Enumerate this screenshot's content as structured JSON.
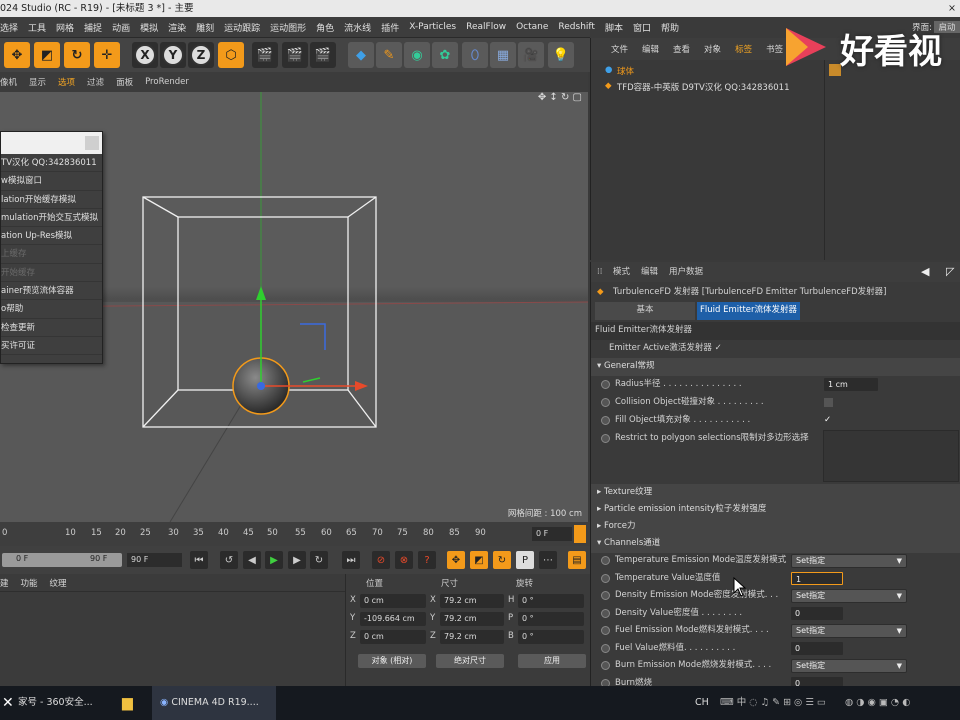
{
  "title_bar": {
    "title": "024 Studio (RC - R19) - [未标题 3 *] - 主要",
    "close": "×"
  },
  "menu": [
    "选择",
    "工具",
    "网格",
    "捕捉",
    "动画",
    "模拟",
    "渲染",
    "雕刻",
    "运动跟踪",
    "运动图形",
    "角色",
    "流水线",
    "插件",
    "X-Particles",
    "RealFlow",
    "Octane",
    "Redshift",
    "脚本",
    "窗口",
    "帮助"
  ],
  "viewport_menu": [
    "像机",
    "显示",
    "选项",
    "过滤",
    "面板",
    "ProRender"
  ],
  "popup_items": [
    "TV汉化 QQ:342836011",
    "w模拟窗口",
    "lation开始缓存模拟",
    "mulation开始交互式模拟",
    "ation Up-Res模拟",
    "上缓存",
    "开始缓存",
    "ainer预览流体容器",
    "o帮助",
    "检查更新",
    "买许可证"
  ],
  "viewport": {
    "grid_spacing": "网格间距 : 100 cm"
  },
  "timeline": {
    "ticks": [
      "0",
      "10",
      "15",
      "20",
      "25",
      "30",
      "35",
      "40",
      "45",
      "50",
      "55",
      "60",
      "65",
      "70",
      "75",
      "80",
      "85",
      "90"
    ],
    "current": "0 F"
  },
  "playback": {
    "start": "0 F",
    "end": "90 F",
    "end2": "90 F"
  },
  "lower_left": {
    "tabs": [
      "建",
      "功能",
      "纹理"
    ]
  },
  "coords": {
    "headers": [
      "位置",
      "尺寸",
      "旋转"
    ],
    "rows": [
      {
        "axis": "X",
        "pos": "0 cm",
        "size_axis": "X",
        "size": "79.2 cm",
        "rot_axis": "H",
        "rot": "0 °"
      },
      {
        "axis": "Y",
        "pos": "-109.664 cm",
        "size_axis": "Y",
        "size": "79.2 cm",
        "rot_axis": "P",
        "rot": "0 °"
      },
      {
        "axis": "Z",
        "pos": "0 cm",
        "size_axis": "Z",
        "size": "79.2 cm",
        "rot_axis": "B",
        "rot": "0 °"
      }
    ],
    "mode": "对象 (相对)",
    "size_mode": "绝对尺寸",
    "apply": "应用"
  },
  "object_manager": {
    "tabs": [
      "文件",
      "编辑",
      "查看",
      "对象",
      "标签",
      "书签"
    ],
    "objects": [
      "球体",
      "TFD容器-中英版 D9TV汉化 QQ:342836011"
    ],
    "layout_label": "界面:",
    "layout_value": "启动"
  },
  "logo": {
    "text": "好看视"
  },
  "attributes": {
    "tabs": [
      "模式",
      "编辑",
      "用户数据"
    ],
    "object_title": "TurbulenceFD 发射器 [TurbulenceFD Emitter TurbulenceFD发射器]",
    "subtabs": [
      "基本",
      "Fluid Emitter流体发射器"
    ],
    "section_title": "Fluid Emitter流体发射器",
    "emitter_active": "Emitter Active激活发射器 ✓",
    "general": "General常规",
    "radius_label": "Radius半径 . . . . . . . . . . . . . . .",
    "radius_value": "1 cm",
    "collision_label": "Collision Object碰撞对象 . . . . . . . . .",
    "fill_label": "Fill Object填充对象 . . . . . . . . . . .",
    "restrict_label": "Restrict to polygon selections限制对多边形选择",
    "texture": "Texture纹理",
    "particle": "Particle emission intensity粒子发射强度",
    "force": "Force力",
    "channels": "Channels通道",
    "channel_rows": [
      {
        "label": "Temperature Emission Mode温度发射模式",
        "value": "Set指定",
        "type": "select"
      },
      {
        "label": "Temperature Value温度值",
        "value": "1",
        "type": "num"
      },
      {
        "label": "Density Emission Mode密度发射模式. . .",
        "value": "Set指定",
        "type": "select"
      },
      {
        "label": "Density Value密度值 . . . . . . . .",
        "value": "0",
        "type": "num"
      },
      {
        "label": "Fuel Emission Mode燃料发射模式. . . .",
        "value": "Set指定",
        "type": "select"
      },
      {
        "label": "Fuel Value燃料值. . . . . . . . . .",
        "value": "0",
        "type": "num"
      },
      {
        "label": "Burn Emission Mode燃烧发射模式. . . .",
        "value": "Set指定",
        "type": "select"
      },
      {
        "label": "Burn燃烧",
        "value": "0",
        "type": "num"
      }
    ]
  },
  "taskbar": {
    "item1": "家号 - 360安全...",
    "item2": "CINEMA 4D R19....",
    "tray": "CH"
  },
  "colors": {
    "accent": "#f39a1a",
    "selection": "#1e5fa8"
  }
}
